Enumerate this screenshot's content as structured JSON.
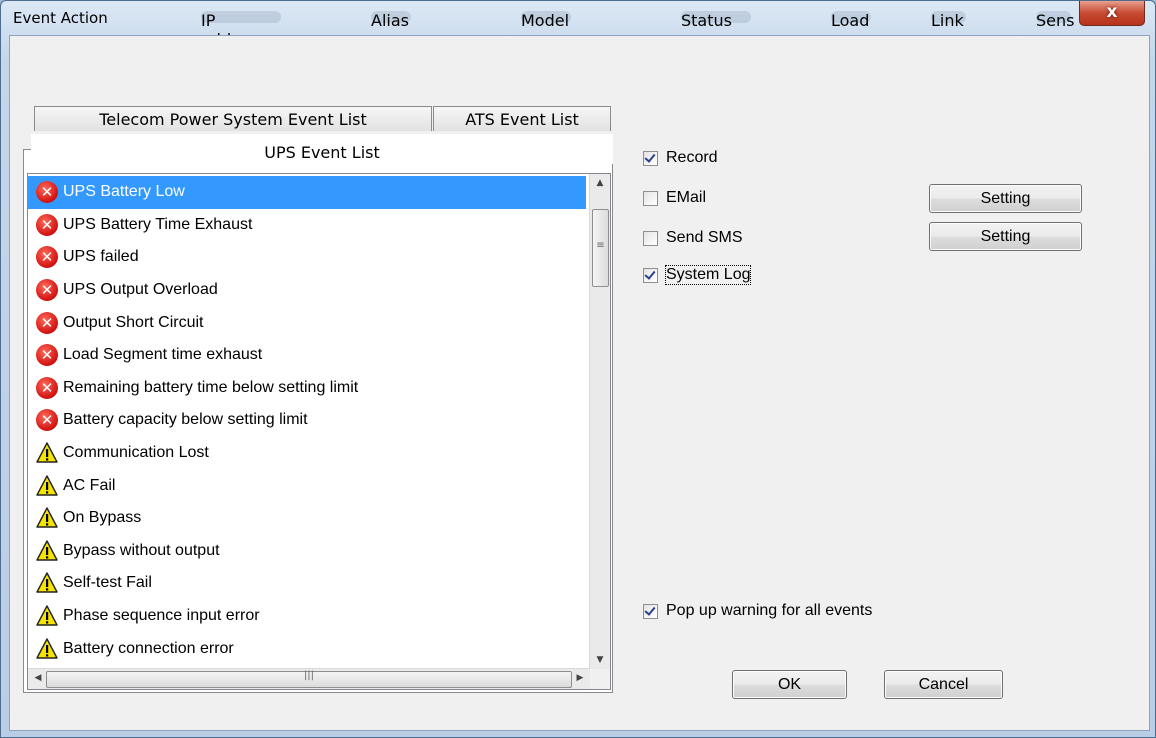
{
  "window": {
    "title": "Event Action",
    "close_glyph": "x",
    "ghost_header": [
      "IP address",
      "Alias",
      "Model",
      "Status",
      "Load",
      "Link",
      "Sens"
    ]
  },
  "tabs": {
    "telecom": "Telecom Power System Event List",
    "ats": "ATS Event List",
    "ups": "UPS Event List"
  },
  "events": [
    {
      "label": "UPS Battery Low",
      "icon": "error-icon",
      "selected": true
    },
    {
      "label": "UPS Battery Time Exhaust",
      "icon": "error-icon"
    },
    {
      "label": "UPS failed",
      "icon": "error-icon"
    },
    {
      "label": "UPS Output Overload",
      "icon": "error-icon"
    },
    {
      "label": "Output Short Circuit",
      "icon": "error-icon"
    },
    {
      "label": "Load Segment time exhaust",
      "icon": "error-icon"
    },
    {
      "label": "Remaining battery time below setting limit",
      "icon": "error-icon"
    },
    {
      "label": "Battery capacity below setting limit",
      "icon": "error-icon"
    },
    {
      "label": "Communication Lost",
      "icon": "warning-icon"
    },
    {
      "label": "AC Fail",
      "icon": "warning-icon"
    },
    {
      "label": "On Bypass",
      "icon": "warning-icon"
    },
    {
      "label": "Bypass without output",
      "icon": "warning-icon"
    },
    {
      "label": "Self-test Fail",
      "icon": "warning-icon"
    },
    {
      "label": "Phase sequence input error",
      "icon": "warning-icon"
    },
    {
      "label": "Battery connection error",
      "icon": "warning-icon"
    }
  ],
  "actions": {
    "record": {
      "label": "Record",
      "checked": true
    },
    "email": {
      "label": "EMail",
      "checked": false
    },
    "sms": {
      "label": "Send SMS",
      "checked": false
    },
    "syslog": {
      "label": "System Log",
      "checked": true
    },
    "setting_label": "Setting",
    "popup": {
      "label": "Pop up warning for all events",
      "checked": true
    }
  },
  "buttons": {
    "ok": "OK",
    "cancel": "Cancel"
  },
  "colors": {
    "selection": "#3399ff",
    "close_button": "#c74a32"
  }
}
